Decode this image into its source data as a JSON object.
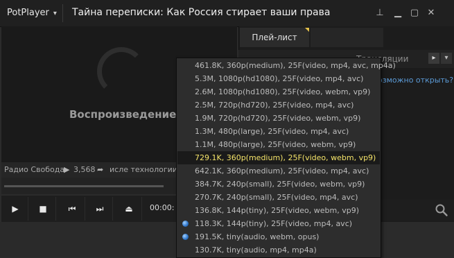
{
  "app": {
    "menu_label": "PotPlayer",
    "window_title": "Тайна переписки: Как Россия стирает ваши права"
  },
  "window_buttons": [
    {
      "name": "pin-icon",
      "glyph": "⊥"
    },
    {
      "name": "minimize-icon",
      "glyph": "▁"
    },
    {
      "name": "maximize-icon",
      "glyph": "▢"
    },
    {
      "name": "close-icon",
      "glyph": "✕"
    }
  ],
  "player": {
    "status_text": "Воспроизведение...",
    "channel": "Радио Свобода",
    "views": "3,568",
    "description_fragment": "исле технологии",
    "time": "00:00:"
  },
  "controls": {
    "play_icon": "▶",
    "stop_icon": "■",
    "prev_icon": "⏮",
    "next_icon": "⏭",
    "eject_icon": "⏏"
  },
  "playlist": {
    "tab_label": "Плей-лист",
    "subtab_broadcasts": "Трансляции",
    "open_link": "озможно открыть?"
  },
  "format_menu": {
    "items": [
      {
        "label": "461.8K, 360p(medium), 25F(video, mp4, avc, mp4a)",
        "highlighted": false,
        "selected": false
      },
      {
        "label": "5.3M, 1080p(hd1080), 25F(video, mp4, avc)",
        "highlighted": false,
        "selected": false
      },
      {
        "label": "2.6M, 1080p(hd1080), 25F(video, webm, vp9)",
        "highlighted": false,
        "selected": false
      },
      {
        "label": "2.5M, 720p(hd720), 25F(video, mp4, avc)",
        "highlighted": false,
        "selected": false
      },
      {
        "label": "1.9M, 720p(hd720), 25F(video, webm, vp9)",
        "highlighted": false,
        "selected": false
      },
      {
        "label": "1.3M, 480p(large), 25F(video, mp4, avc)",
        "highlighted": false,
        "selected": false
      },
      {
        "label": "1.1M, 480p(large), 25F(video, webm, vp9)",
        "highlighted": false,
        "selected": false
      },
      {
        "label": "729.1K, 360p(medium), 25F(video, webm, vp9)",
        "highlighted": true,
        "selected": false
      },
      {
        "label": "642.1K, 360p(medium), 25F(video, mp4, avc)",
        "highlighted": false,
        "selected": false
      },
      {
        "label": "384.7K, 240p(small), 25F(video, webm, vp9)",
        "highlighted": false,
        "selected": false
      },
      {
        "label": "270.7K, 240p(small), 25F(video, mp4, avc)",
        "highlighted": false,
        "selected": false
      },
      {
        "label": "136.8K, 144p(tiny), 25F(video, webm, vp9)",
        "highlighted": false,
        "selected": false
      },
      {
        "label": "118.3K, 144p(tiny), 25F(video, mp4, avc)",
        "highlighted": false,
        "selected": true
      },
      {
        "label": "191.5K, tiny(audio, webm, opus)",
        "highlighted": false,
        "selected": true
      },
      {
        "label": "130.7K, tiny(audio, mp4, mp4a)",
        "highlighted": false,
        "selected": false
      }
    ]
  },
  "colors": {
    "highlight_text": "#f5e46a",
    "link": "#5b9ad6",
    "accent_corner": "#e3c04a"
  }
}
